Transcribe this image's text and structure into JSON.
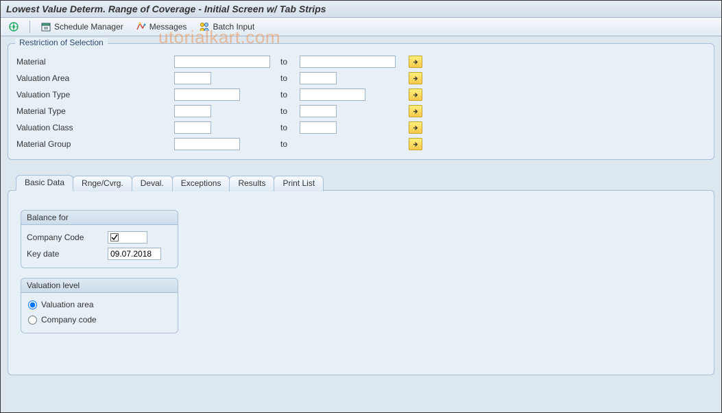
{
  "title": "Lowest Value Determ. Range of Coverage - Initial Screen w/ Tab Strips",
  "watermark": "utorialkart.com",
  "toolbar": {
    "execute_label": "",
    "schedule_label": "Schedule Manager",
    "messages_label": "Messages",
    "batch_label": "Batch Input"
  },
  "restriction": {
    "title": "Restriction of Selection",
    "rows": [
      {
        "label": "Material",
        "to": "to",
        "fromW": "wide",
        "toW": "wide"
      },
      {
        "label": "Valuation Area",
        "to": "to",
        "fromW": "small",
        "toW": "small"
      },
      {
        "label": "Valuation Type",
        "to": "to",
        "fromW": "med",
        "toW": "med"
      },
      {
        "label": "Material Type",
        "to": "to",
        "fromW": "small",
        "toW": "small"
      },
      {
        "label": "Valuation Class",
        "to": "to",
        "fromW": "small",
        "toW": "small"
      },
      {
        "label": "Material Group",
        "to": "to",
        "fromW": "med",
        "toW": ""
      }
    ]
  },
  "tabs": [
    {
      "label": "Basic Data",
      "active": true
    },
    {
      "label": "Rnge/Cvrg."
    },
    {
      "label": "Deval."
    },
    {
      "label": "Exceptions"
    },
    {
      "label": "Results"
    },
    {
      "label": "Print List"
    }
  ],
  "basic_data": {
    "balance_title": "Balance for",
    "company_code_label": "Company Code",
    "company_code_checked": true,
    "key_date_label": "Key date",
    "key_date_value": "09.07.2018",
    "valuation_title": "Valuation level",
    "radio_valuation_area": "Valuation area",
    "radio_company_code": "Company code",
    "valuation_level_selected": "area"
  }
}
